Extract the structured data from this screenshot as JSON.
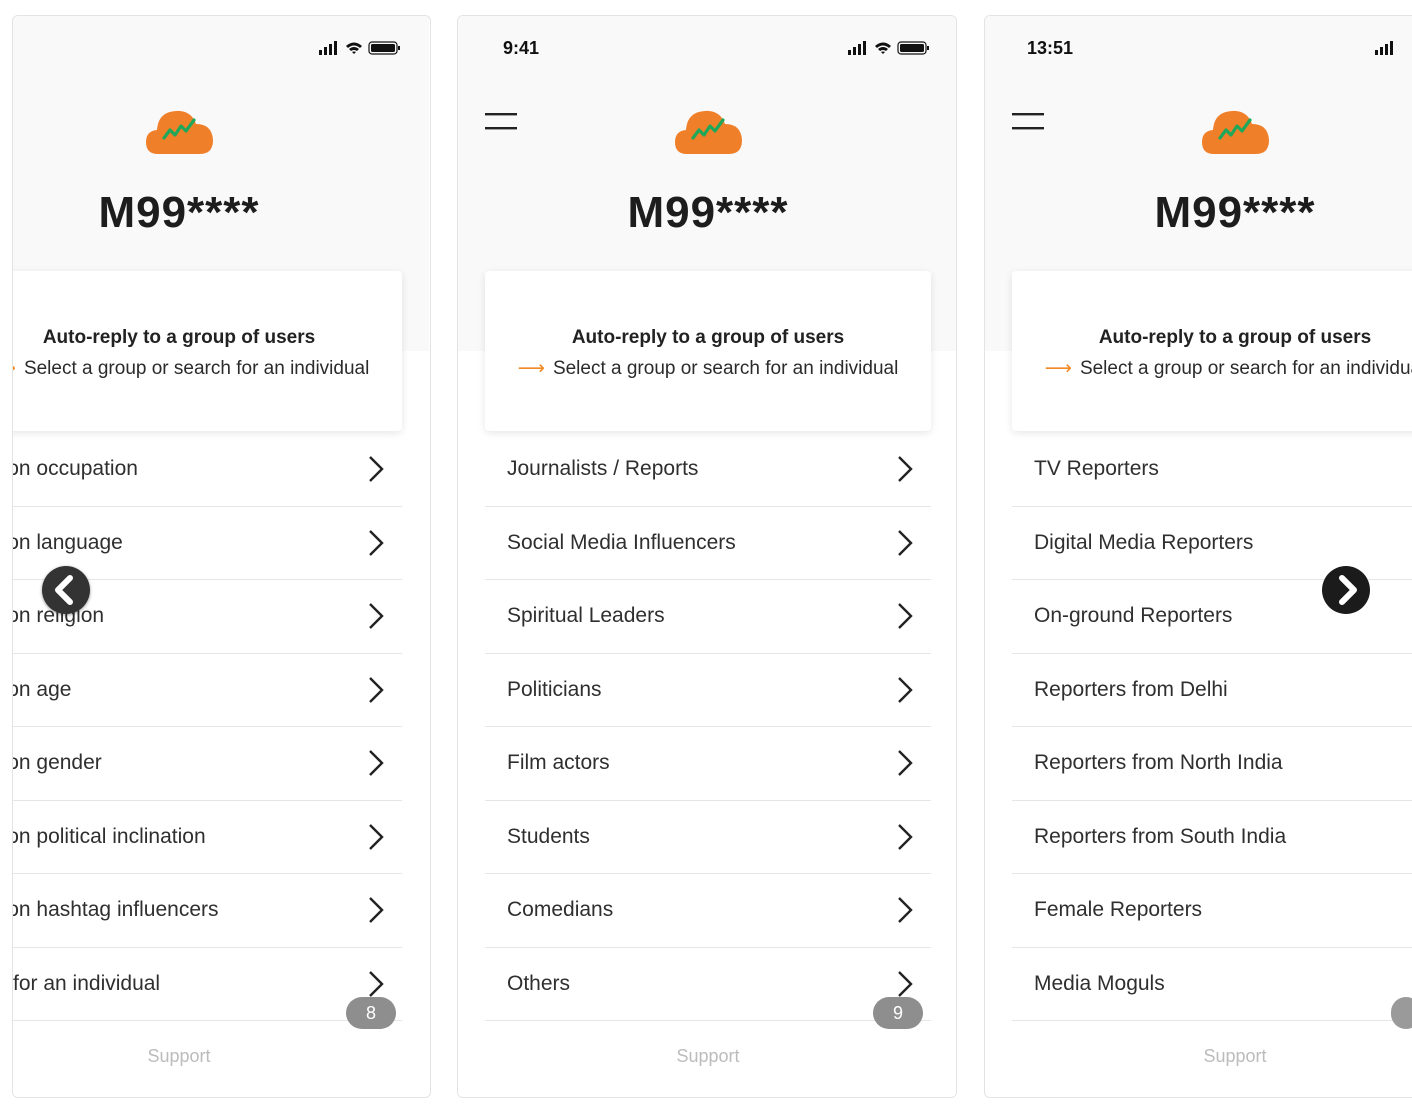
{
  "app": {
    "brand": "M99****",
    "card_title": "Auto-reply to a group of users",
    "card_subtitle": "Select a group or search for an individual",
    "support_label": "Support"
  },
  "screens": [
    {
      "status_time": "",
      "page_number": "8",
      "items": [
        "ed on occupation",
        "ed on language",
        "ed on religion",
        "ed on age",
        "ed on gender",
        "ed on political inclination",
        "ed on hashtag influencers",
        "rch for an individual"
      ]
    },
    {
      "status_time": "9:41",
      "page_number": "9",
      "items": [
        "Journalists / Reports",
        "Social Media Influencers",
        "Spiritual Leaders",
        "Politicians",
        "Film actors",
        "Students",
        "Comedians",
        "Others"
      ]
    },
    {
      "status_time": "13:51",
      "page_number": "",
      "items": [
        "TV Reporters",
        "Digital Media Reporters",
        "On-ground Reporters",
        "Reporters from Delhi",
        "Reporters from North India",
        "Reporters from South India",
        "Female Reporters",
        "Media Moguls"
      ]
    }
  ],
  "colors": {
    "accent_orange": "#f08a24",
    "logo_orange": "#f07f2a",
    "logo_green": "#1fa85a"
  },
  "icons": {
    "prev": "chevron-left-icon",
    "next": "chevron-right-icon",
    "row": "chevron-right-icon",
    "menu": "hamburger-menu-icon",
    "logo": "cloud-logo-icon"
  }
}
